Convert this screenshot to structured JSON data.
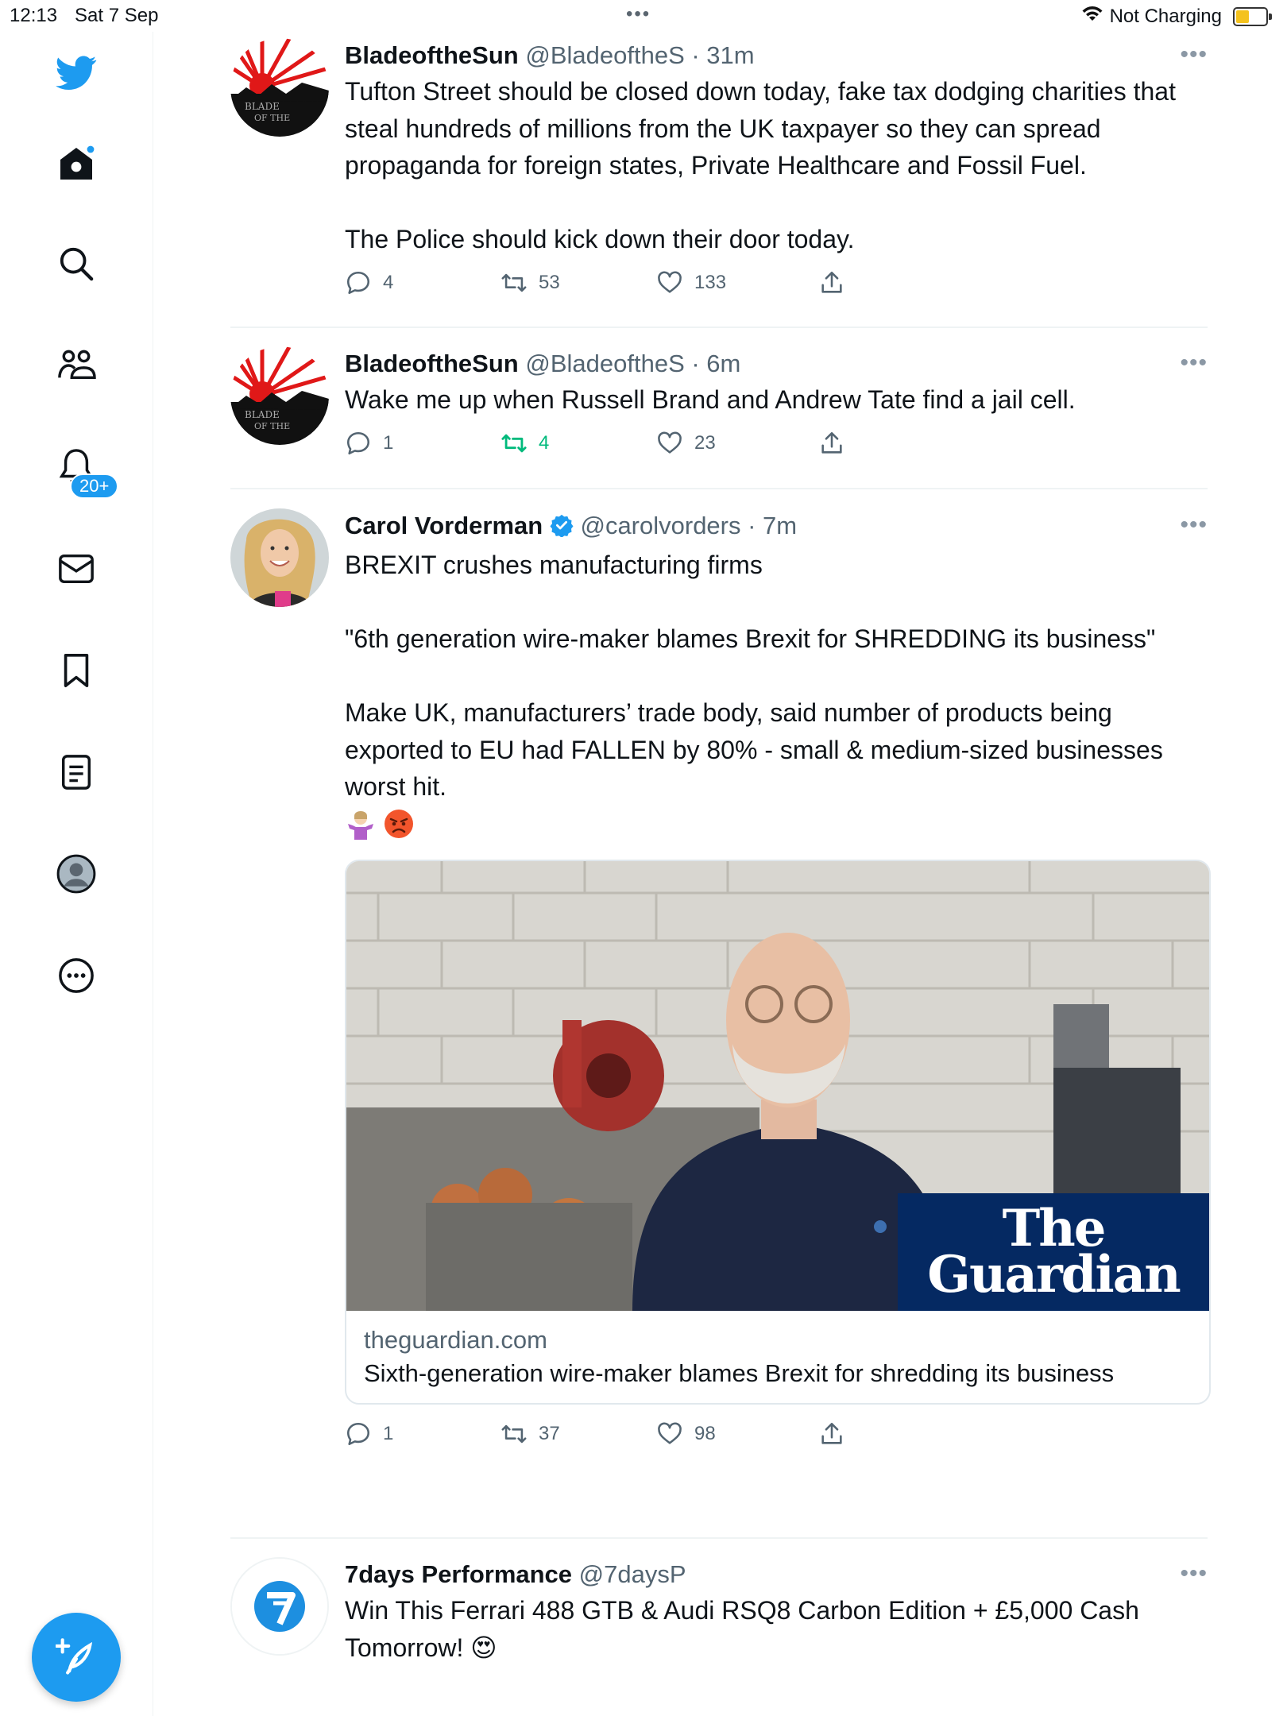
{
  "status_bar": {
    "time": "12:13",
    "date": "Sat 7 Sep",
    "grabber": "•••",
    "charging": "Not Charging"
  },
  "sidebar": {
    "icons": [
      "twitter-logo-icon",
      "home-icon",
      "search-icon",
      "communities-icon",
      "notifications-icon",
      "messages-icon",
      "bookmarks-icon",
      "lists-icon",
      "profile-icon",
      "more-icon"
    ],
    "notifications_badge": "20+",
    "accent": "#1d9bf0"
  },
  "tweets": [
    {
      "name": "BladeoftheSun",
      "handle": "@BladeoftheS",
      "time": "· 31m",
      "text": "Tufton Street should be closed down today, fake tax dodging charities that steal hundreds of millions from the UK taxpayer so they can spread propaganda for foreign states, Private Healthcare and Fossil Fuel.\n\nThe Police should kick down their door today.",
      "replies": "4",
      "retweets": "53",
      "likes": "133"
    },
    {
      "name": "BladeoftheSun",
      "handle": "@BladeoftheS",
      "time": "· 6m",
      "text": "Wake me up when Russell Brand and Andrew Tate find a jail cell.",
      "replies": "1",
      "retweets": "4",
      "likes": "23"
    },
    {
      "name": "Carol Vorderman",
      "handle": "@carolvorders",
      "time": "· 7m",
      "verified": true,
      "text": "BREXIT crushes manufacturing firms\n\n\"6th generation wire-maker blames Brexit for SHREDDING its business\"\n\nMake UK, manufacturers’ trade body, said number of products being exported to EU had FALLEN by 80% - small & medium-sized businesses worst hit.\n",
      "emojis": [
        "shrug-emoji",
        "angry-face-emoji"
      ],
      "card": {
        "brand_line1": "The",
        "brand_line2": "Guardian",
        "domain": "theguardian.com",
        "title": "Sixth-generation wire-maker blames Brexit for shredding its business"
      },
      "replies": "1",
      "retweets": "37",
      "likes": "98"
    },
    {
      "name": "7days Performance",
      "handle": "@7daysP",
      "time": "",
      "text": "Win This Ferrari 488 GTB & Audi RSQ8 Carbon Edition + £5,000 Cash Tomorrow! 😍"
    }
  ]
}
